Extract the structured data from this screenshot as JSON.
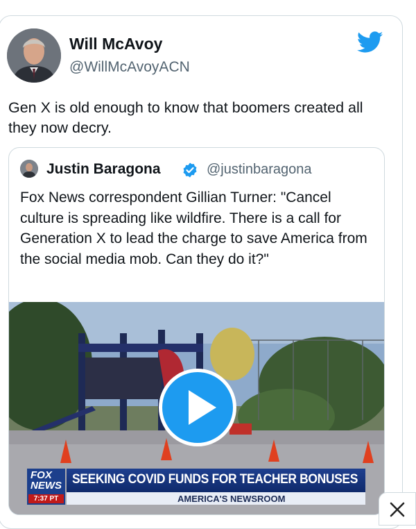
{
  "tweet": {
    "author": {
      "name": "Will McAvoy",
      "handle": "@WillMcAvoyACN"
    },
    "text": "Gen X is old enough to know that boomers created all they now decry.",
    "platform_icon": "twitter-bird-icon",
    "brand_color": "#1d9bf0"
  },
  "quoted_tweet": {
    "author": {
      "name": "Justin Baragona",
      "handle": "@justinbaragona",
      "verified": true
    },
    "text": "Fox News correspondent Gillian Turner: \"Cancel culture is spreading like wildfire. There is a call for Generation X to lead the charge to save America from the social media mob. Can they do it?\"",
    "video": {
      "channel_logo_top": "FOX",
      "channel_logo_bottom": "NEWS",
      "time": "7:37 PT",
      "headline": "SEEKING COVID FUNDS FOR TEACHER BONUSES",
      "show": "AMERICA'S NEWSROOM",
      "play_icon": "play-icon"
    }
  },
  "close_icon": "close-icon"
}
